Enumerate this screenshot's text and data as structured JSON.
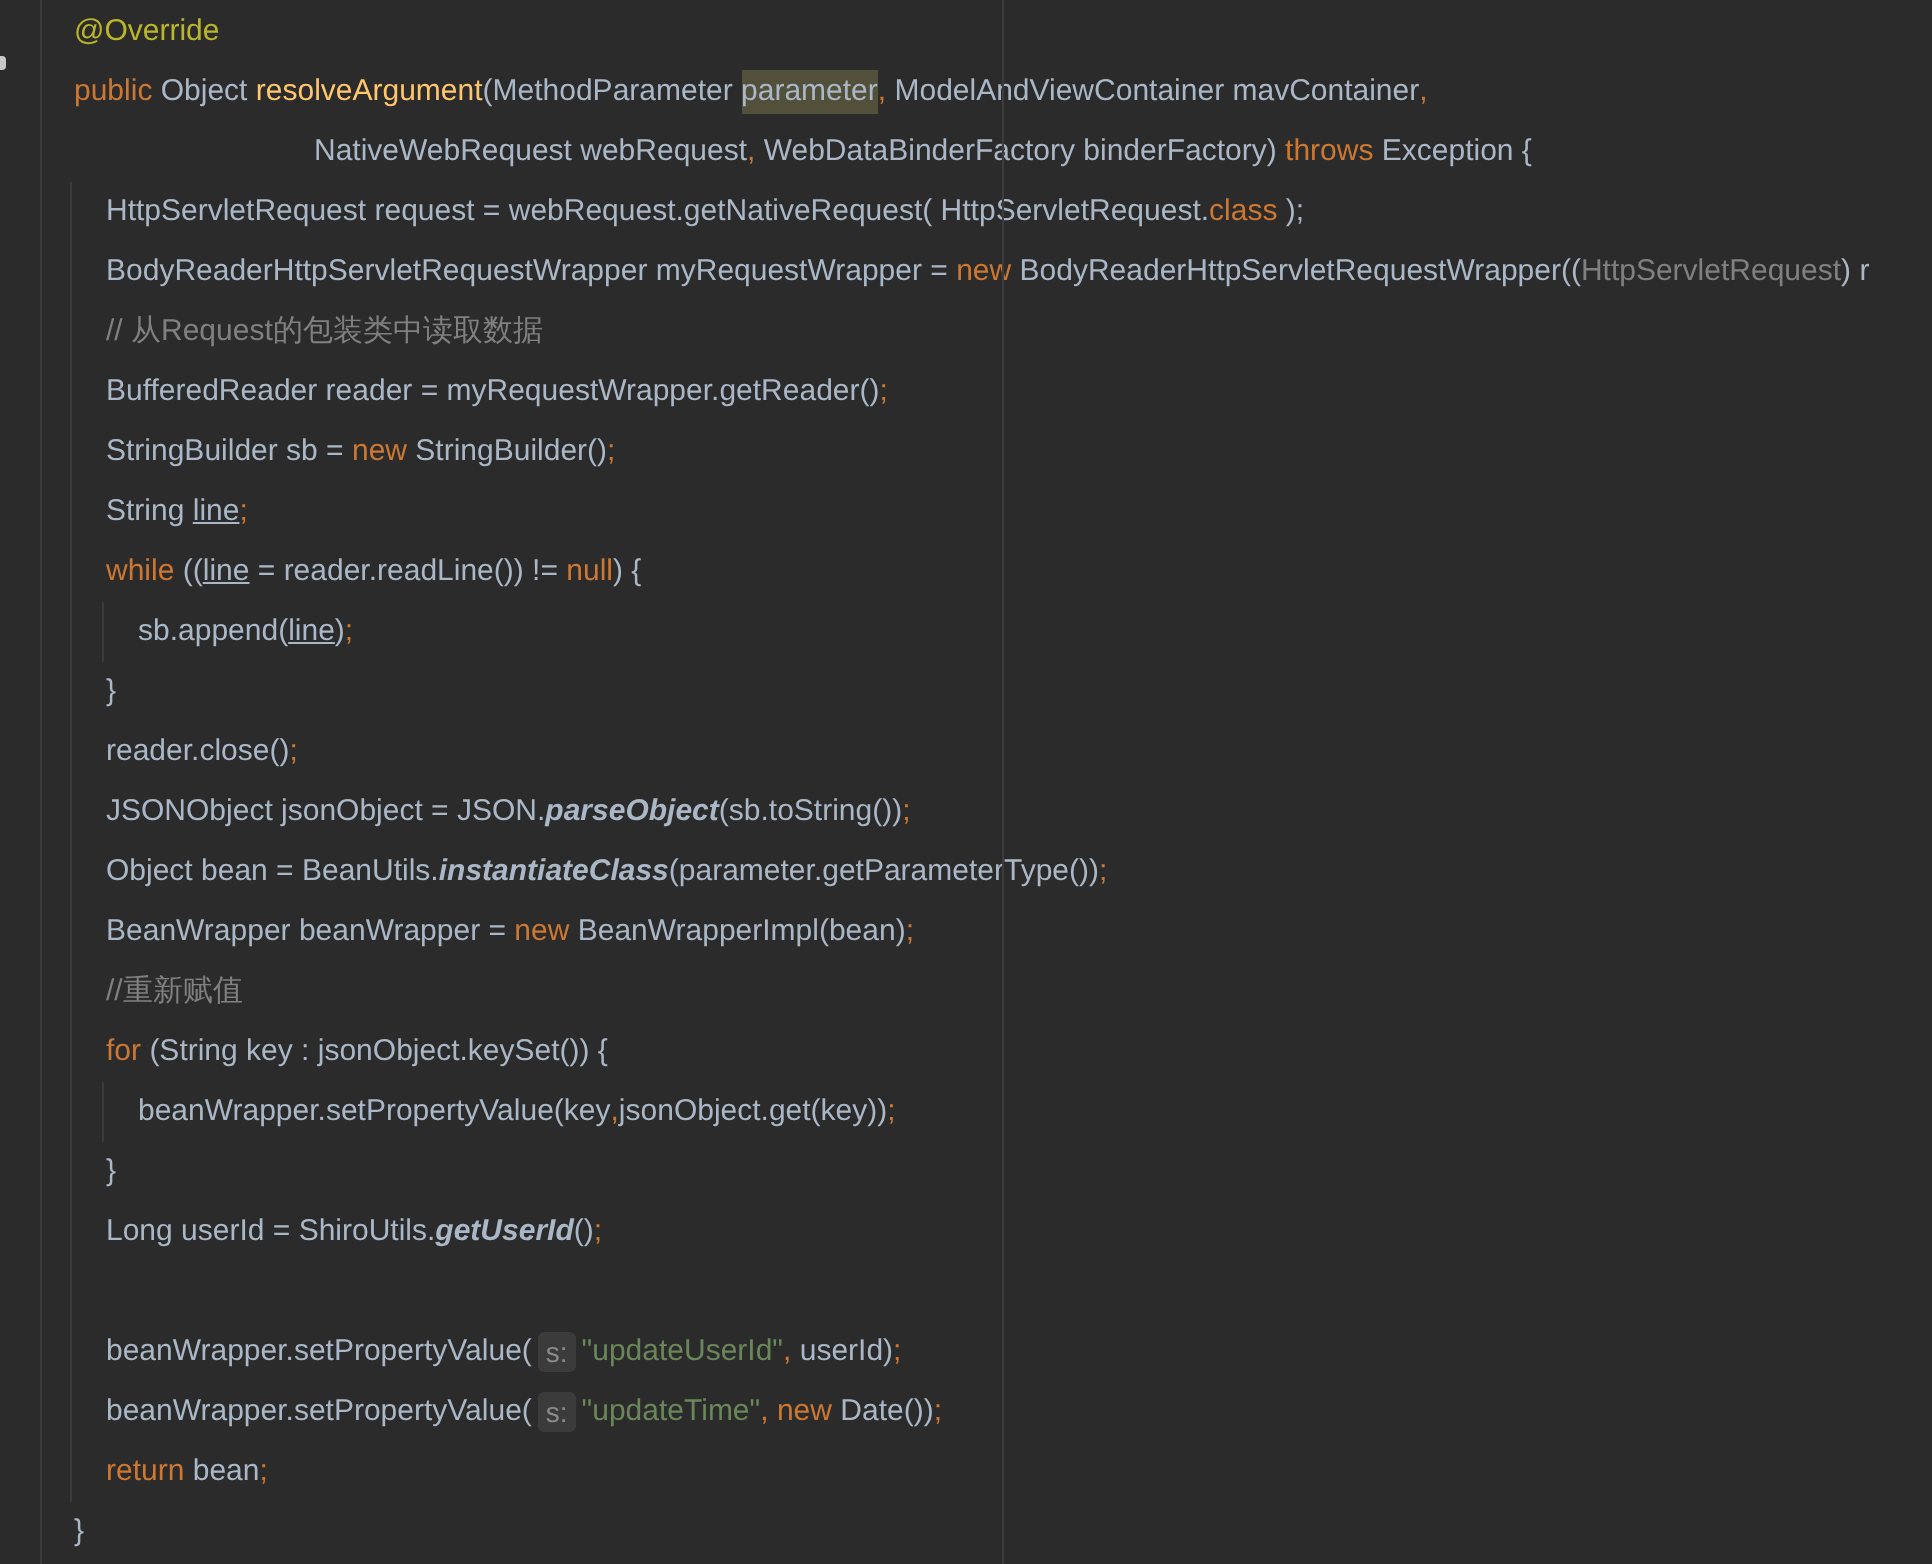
{
  "editor": {
    "lines": [
      {
        "tokens": [
          {
            "kind": "annotation",
            "text": "@Override"
          }
        ]
      },
      {
        "tokens": [
          {
            "kind": "keyword",
            "text": "public "
          },
          {
            "kind": "plain",
            "text": "Object "
          },
          {
            "kind": "method",
            "text": "resolveArgument"
          },
          {
            "kind": "plain",
            "text": "(MethodParameter "
          },
          {
            "kind": "highlight",
            "text": "parameter"
          },
          {
            "kind": "punct",
            "text": ", "
          },
          {
            "kind": "plain",
            "text": "ModelAndViewContainer mavContainer"
          },
          {
            "kind": "punct",
            "text": ","
          }
        ],
        "continuation": {
          "tokens": [
            {
              "kind": "plain",
              "text": "NativeWebRequest webRequest"
            },
            {
              "kind": "punct",
              "text": ", "
            },
            {
              "kind": "plain",
              "text": "WebDataBinderFactory binderFactory) "
            },
            {
              "kind": "keyword",
              "text": "throws "
            },
            {
              "kind": "plain",
              "text": "Exception {"
            }
          ]
        },
        "children": [
          {
            "tokens": [
              {
                "kind": "plain",
                "text": "HttpServletRequest request = webRequest.getNativeRequest( HttpServletRequest."
              },
              {
                "kind": "keyword",
                "text": "class "
              },
              {
                "kind": "plain",
                "text": ");"
              }
            ]
          },
          {
            "tokens": [
              {
                "kind": "plain",
                "text": "BodyReaderHttpServletRequestWrapper myRequestWrapper = "
              },
              {
                "kind": "keyword",
                "text": "new "
              },
              {
                "kind": "plain",
                "text": "BodyReaderHttpServletRequestWrapper(("
              },
              {
                "kind": "cast",
                "text": "HttpServletRequest"
              },
              {
                "kind": "plain",
                "text": ") r"
              }
            ]
          },
          {
            "tokens": [
              {
                "kind": "comment",
                "text": "// 从Request的包装类中读取数据"
              }
            ]
          },
          {
            "tokens": [
              {
                "kind": "plain",
                "text": "BufferedReader reader = myRequestWrapper.getReader()"
              },
              {
                "kind": "punct",
                "text": ";"
              }
            ]
          },
          {
            "tokens": [
              {
                "kind": "plain",
                "text": "StringBuilder sb = "
              },
              {
                "kind": "keyword",
                "text": "new "
              },
              {
                "kind": "plain",
                "text": "StringBuilder()"
              },
              {
                "kind": "punct",
                "text": ";"
              }
            ]
          },
          {
            "tokens": [
              {
                "kind": "plain",
                "text": "String "
              },
              {
                "kind": "underline",
                "text": "line"
              },
              {
                "kind": "punct",
                "text": ";"
              }
            ]
          },
          {
            "tokens": [
              {
                "kind": "keyword",
                "text": "while "
              },
              {
                "kind": "plain",
                "text": "(("
              },
              {
                "kind": "underline",
                "text": "line"
              },
              {
                "kind": "plain",
                "text": " = reader.readLine()) != "
              },
              {
                "kind": "keyword",
                "text": "null"
              },
              {
                "kind": "plain",
                "text": ") {"
              }
            ],
            "children": [
              {
                "tokens": [
                  {
                    "kind": "plain",
                    "text": "sb.append("
                  },
                  {
                    "kind": "underline",
                    "text": "line"
                  },
                  {
                    "kind": "plain",
                    "text": ")"
                  },
                  {
                    "kind": "punct",
                    "text": ";"
                  }
                ]
              }
            ]
          },
          {
            "tokens": [
              {
                "kind": "plain",
                "text": "}"
              }
            ]
          },
          {
            "tokens": [
              {
                "kind": "plain",
                "text": "reader.close()"
              },
              {
                "kind": "punct",
                "text": ";"
              }
            ]
          },
          {
            "tokens": [
              {
                "kind": "plain",
                "text": "JSONObject jsonObject = JSON."
              },
              {
                "kind": "italic",
                "text": "parseObject"
              },
              {
                "kind": "plain",
                "text": "(sb.toString())"
              },
              {
                "kind": "punct",
                "text": ";"
              }
            ]
          },
          {
            "tokens": [
              {
                "kind": "plain",
                "text": "Object bean = BeanUtils."
              },
              {
                "kind": "italic",
                "text": "instantiateClass"
              },
              {
                "kind": "plain",
                "text": "(parameter.getParameterType())"
              },
              {
                "kind": "punct",
                "text": ";"
              }
            ]
          },
          {
            "tokens": [
              {
                "kind": "plain",
                "text": "BeanWrapper beanWrapper = "
              },
              {
                "kind": "keyword",
                "text": "new "
              },
              {
                "kind": "plain",
                "text": "BeanWrapperImpl(bean)"
              },
              {
                "kind": "punct",
                "text": ";"
              }
            ]
          },
          {
            "tokens": [
              {
                "kind": "comment",
                "text": "//重新赋值"
              }
            ]
          },
          {
            "tokens": [
              {
                "kind": "keyword",
                "text": "for "
              },
              {
                "kind": "plain",
                "text": "(String key : jsonObject.keySet()) {"
              }
            ],
            "children": [
              {
                "tokens": [
                  {
                    "kind": "plain",
                    "text": "beanWrapper.setPropertyValue(key"
                  },
                  {
                    "kind": "punct",
                    "text": ","
                  },
                  {
                    "kind": "plain",
                    "text": "jsonObject.get(key))"
                  },
                  {
                    "kind": "punct",
                    "text": ";"
                  }
                ]
              }
            ]
          },
          {
            "tokens": [
              {
                "kind": "plain",
                "text": "}"
              }
            ]
          },
          {
            "tokens": [
              {
                "kind": "plain",
                "text": "Long userId = ShiroUtils."
              },
              {
                "kind": "italic",
                "text": "getUserId"
              },
              {
                "kind": "plain",
                "text": "()"
              },
              {
                "kind": "punct",
                "text": ";"
              }
            ]
          },
          {
            "kind": "blank"
          },
          {
            "tokens": [
              {
                "kind": "plain",
                "text": "beanWrapper.setPropertyValue("
              },
              {
                "kind": "hint",
                "text": "s:"
              },
              {
                "kind": "string",
                "text": "\"updateUserId\""
              },
              {
                "kind": "punct",
                "text": ", "
              },
              {
                "kind": "plain",
                "text": "userId)"
              },
              {
                "kind": "punct",
                "text": ";"
              }
            ]
          },
          {
            "tokens": [
              {
                "kind": "plain",
                "text": "beanWrapper.setPropertyValue("
              },
              {
                "kind": "hint",
                "text": "s:"
              },
              {
                "kind": "string",
                "text": "\"updateTime\""
              },
              {
                "kind": "punct",
                "text": ", "
              },
              {
                "kind": "keyword",
                "text": "new "
              },
              {
                "kind": "plain",
                "text": "Date())"
              },
              {
                "kind": "punct",
                "text": ";"
              }
            ]
          },
          {
            "tokens": [
              {
                "kind": "keyword",
                "text": "return "
              },
              {
                "kind": "plain",
                "text": "bean"
              },
              {
                "kind": "punct",
                "text": ";"
              }
            ]
          }
        ]
      },
      {
        "tokens": [
          {
            "kind": "plain",
            "text": "}"
          }
        ]
      }
    ]
  }
}
